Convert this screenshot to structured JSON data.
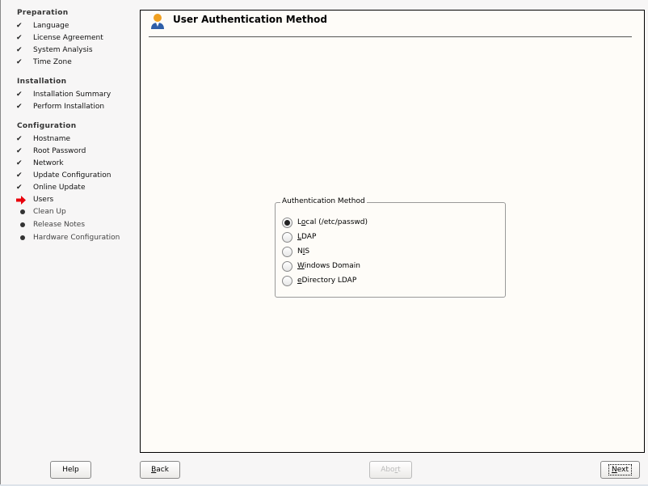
{
  "sidebar": {
    "sections": [
      {
        "title": "Preparation",
        "items": [
          {
            "label": "Language",
            "status": "done"
          },
          {
            "label": "License Agreement",
            "status": "done"
          },
          {
            "label": "System Analysis",
            "status": "done"
          },
          {
            "label": "Time Zone",
            "status": "done"
          }
        ]
      },
      {
        "title": "Installation",
        "items": [
          {
            "label": "Installation Summary",
            "status": "done"
          },
          {
            "label": "Perform Installation",
            "status": "done"
          }
        ]
      },
      {
        "title": "Configuration",
        "items": [
          {
            "label": "Hostname",
            "status": "done"
          },
          {
            "label": "Root Password",
            "status": "done"
          },
          {
            "label": "Network",
            "status": "done"
          },
          {
            "label": "Update Configuration",
            "status": "done"
          },
          {
            "label": "Online Update",
            "status": "done"
          },
          {
            "label": "Users",
            "status": "current"
          },
          {
            "label": "Clean Up",
            "status": "todo"
          },
          {
            "label": "Release Notes",
            "status": "todo"
          },
          {
            "label": "Hardware Configuration",
            "status": "todo"
          }
        ]
      }
    ]
  },
  "main": {
    "title": "User Authentication Method",
    "title_icon": "user-icon",
    "group": {
      "label": "Authentication Method",
      "options": [
        {
          "pre": "L",
          "key": "o",
          "post": "cal (/etc/passwd)",
          "selected": true
        },
        {
          "pre": "",
          "key": "L",
          "post": "DAP",
          "selected": false
        },
        {
          "pre": "N",
          "key": "I",
          "post": "S",
          "selected": false
        },
        {
          "pre": "",
          "key": "W",
          "post": "indows Domain",
          "selected": false
        },
        {
          "pre": "",
          "key": "e",
          "post": "Directory LDAP",
          "selected": false
        }
      ]
    }
  },
  "buttons": {
    "help": {
      "pre": "Help",
      "key": "",
      "post": ""
    },
    "back": {
      "pre": "",
      "key": "B",
      "post": "ack"
    },
    "abort": {
      "pre": "Abo",
      "key": "r",
      "post": "t",
      "disabled": true
    },
    "next": {
      "pre": "",
      "key": "N",
      "post": "ext",
      "default": true
    }
  },
  "colors": {
    "current_arrow": "#e8000b",
    "panel_bg": "#fefcf8"
  }
}
